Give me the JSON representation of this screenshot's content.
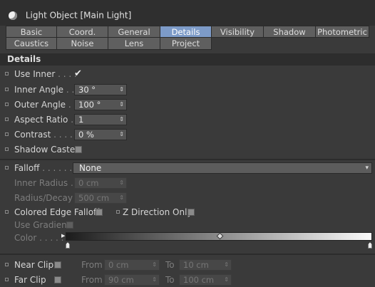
{
  "window": {
    "title": "Light Object [Main Light]"
  },
  "tabs": {
    "row1": [
      "Basic",
      "Coord.",
      "General",
      "Details",
      "Visibility",
      "Shadow",
      "Photometric"
    ],
    "row2": [
      "Caustics",
      "Noise",
      "Lens",
      "Project"
    ],
    "active": "Details"
  },
  "section": {
    "title": "Details"
  },
  "details": {
    "use_inner": {
      "label": "Use Inner",
      "dots": " . . . .",
      "checked": true,
      "check_glyph": "✔"
    },
    "inner_angle": {
      "label": "Inner Angle",
      "dots": " . .",
      "value": "30 °"
    },
    "outer_angle": {
      "label": "Outer Angle",
      "dots": " . .",
      "value": "100 °"
    },
    "aspect_ratio": {
      "label": "Aspect Ratio",
      "dots": " .",
      "value": "1"
    },
    "contrast": {
      "label": "Contrast",
      "dots": " . . . . .",
      "value": "0 %"
    },
    "shadow_caster": {
      "label": "Shadow Caster",
      "checked": false
    }
  },
  "falloff": {
    "label": "Falloff",
    "dots": " . . . . . . . .",
    "value": "None",
    "inner_radius": {
      "label": "Inner Radius",
      "dots": " .",
      "value": "0 cm"
    },
    "radius_decay": {
      "label": "Radius/Decay",
      "value": "500 cm"
    },
    "colored_edge_falloff": {
      "label": "Colored Edge Falloff",
      "checked": false
    },
    "z_direction_only": {
      "label": "Z Direction Only",
      "checked": false
    },
    "use_gradient": {
      "label": "Use Gradient",
      "checked": false
    },
    "color": {
      "label": "Color",
      "dots": " . . . . .",
      "gradient_start": "#1c1c1c",
      "gradient_end": "#fafafa"
    }
  },
  "clipping": {
    "near_clip": {
      "label": "Near Clip",
      "checked": false,
      "from_label": "From",
      "from_value": "0 cm",
      "to_label": "To",
      "to_value": "10 cm"
    },
    "far_clip": {
      "label": "Far Clip",
      "checked": false,
      "from_label": "From",
      "from_value": "90 cm",
      "to_label": "To",
      "to_value": "100 cm"
    }
  },
  "icons": {
    "stepper": "⇕",
    "dropdown": "▾",
    "window": "light-bulb-icon"
  },
  "colors": {
    "active_tab": "#7d9bc8",
    "panel_bg": "#3a3a3a",
    "tab_bg": "#5f5f5f"
  }
}
